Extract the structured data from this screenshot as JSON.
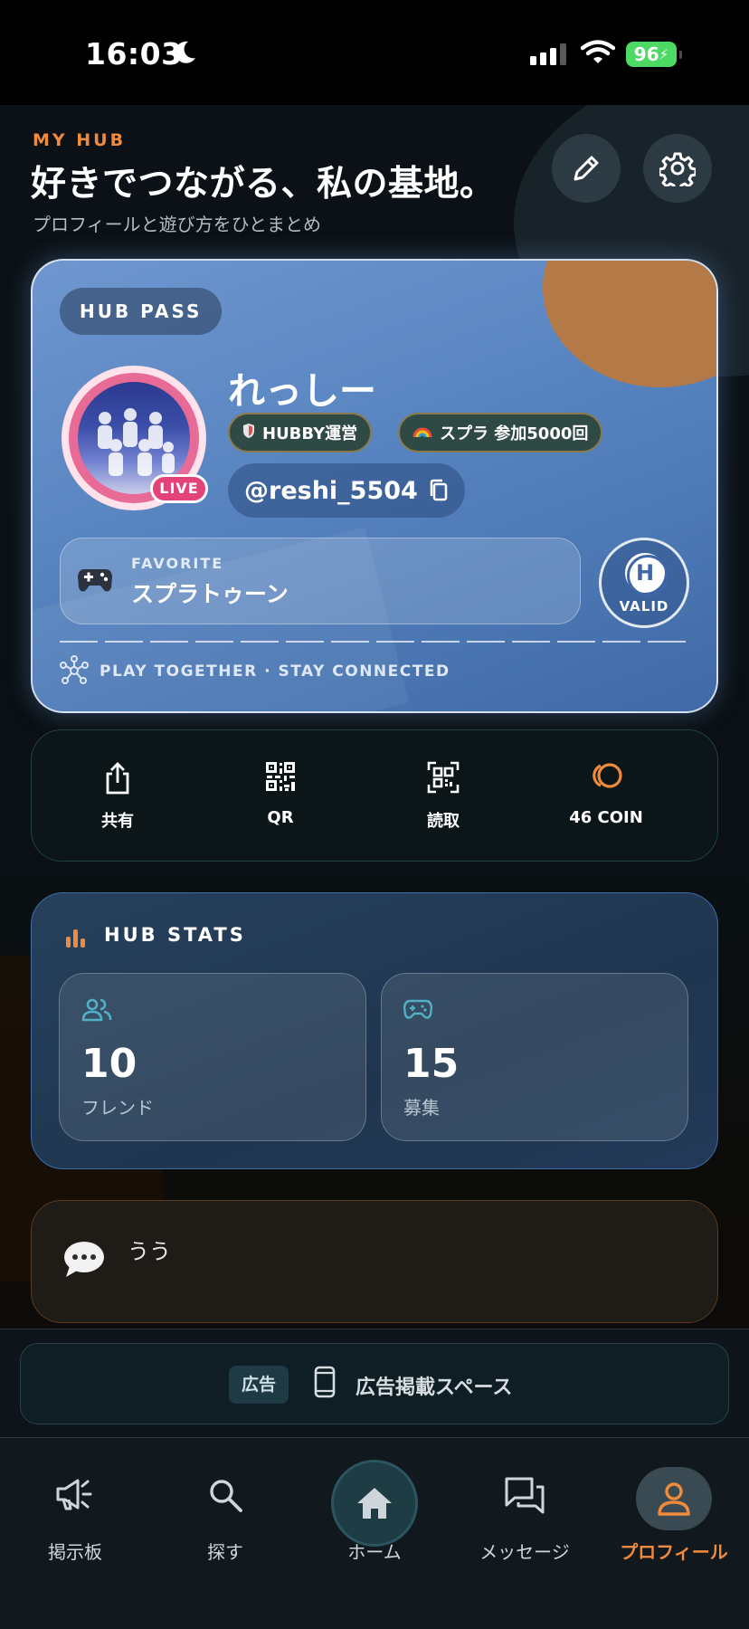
{
  "status_bar": {
    "time": "16:03",
    "battery": "96"
  },
  "header": {
    "label": "MY HUB",
    "title": "好きでつながる、私の基地。",
    "subtitle": "プロフィールと遊び方をひとまとめ"
  },
  "pass": {
    "badge": "HUB PASS",
    "name": "れっしー",
    "live": "LIVE",
    "chips": [
      "HUBBY運営",
      "スプラ 参加5000回"
    ],
    "handle": "@reshi_5504",
    "favorite_label": "FAVORITE",
    "favorite_value": "スプラトゥーン",
    "valid_letter": "H",
    "valid_label": "VALID",
    "tagline": "PLAY TOGETHER · STAY CONNECTED"
  },
  "actions": [
    {
      "label": "共有",
      "icon": "share-icon"
    },
    {
      "label": "QR",
      "icon": "qr-code-icon"
    },
    {
      "label": "読取",
      "icon": "scan-icon"
    },
    {
      "label": "46 COIN",
      "icon": "coin-icon"
    }
  ],
  "stats": {
    "title": "HUB STATS",
    "items": [
      {
        "value": "10",
        "label": "フレンド",
        "icon": "friends-icon"
      },
      {
        "value": "15",
        "label": "募集",
        "icon": "gamepad-icon"
      }
    ]
  },
  "message": {
    "text": "うう"
  },
  "ad": {
    "tag": "広告",
    "text": "広告掲載スペース"
  },
  "tabs": [
    {
      "label": "掲示板",
      "icon": "megaphone-icon"
    },
    {
      "label": "探す",
      "icon": "search-icon"
    },
    {
      "label": "ホーム",
      "icon": "home-icon"
    },
    {
      "label": "メッセージ",
      "icon": "chat-icon"
    },
    {
      "label": "プロフィール",
      "icon": "profile-icon",
      "active": true
    }
  ],
  "colors": {
    "accent": "#f08a3c",
    "card_blue": "#5784c0",
    "teal": "#4fb0c6"
  }
}
